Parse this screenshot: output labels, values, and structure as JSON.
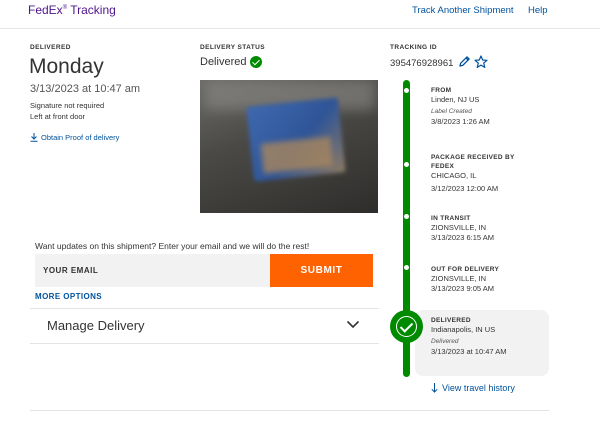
{
  "header": {
    "brand": "FedEx",
    "brand_mark": "®",
    "brand_suffix": "Tracking",
    "track_another": "Track Another Shipment",
    "help": "Help"
  },
  "delivered": {
    "label": "DELIVERED",
    "day": "Monday",
    "datetime": "3/13/2023 at 10:47 am",
    "signature": "Signature not required",
    "left_at": "Left at front door",
    "proof_link": "Obtain Proof of delivery"
  },
  "status": {
    "label": "DELIVERY STATUS",
    "value": "Delivered"
  },
  "tracking": {
    "label": "TRACKING ID",
    "number": "395476928961"
  },
  "timeline": [
    {
      "title": "FROM",
      "location": "Linden, NJ US",
      "note": "Label Created",
      "time": "3/8/2023 1:26 AM"
    },
    {
      "title": "PACKAGE RECEIVED BY",
      "title2": "FEDEX",
      "location": "CHICAGO, IL",
      "time": "3/12/2023 12:00 AM"
    },
    {
      "title": "IN TRANSIT",
      "location": "ZIONSVILLE, IN",
      "time": "3/13/2023 6:15 AM"
    },
    {
      "title": "OUT FOR DELIVERY",
      "location": "ZIONSVILLE, IN",
      "time": "3/13/2023 9:05 AM"
    },
    {
      "title": "DELIVERED",
      "location": "Indianapolis, IN US",
      "note": "Delivered",
      "time": "3/13/2023 at 10:47 AM"
    }
  ],
  "history_link": "View travel history",
  "updates": {
    "prompt": "Want updates on this shipment? Enter your email and we will do the rest!",
    "email_placeholder": "YOUR EMAIL",
    "submit": "SUBMIT",
    "more_options": "MORE OPTIONS"
  },
  "manage": {
    "label": "Manage Delivery"
  },
  "colors": {
    "brand_purple": "#4d148c",
    "link_blue": "#00529b",
    "success_green": "#008a00",
    "submit_orange": "#ff6200"
  }
}
